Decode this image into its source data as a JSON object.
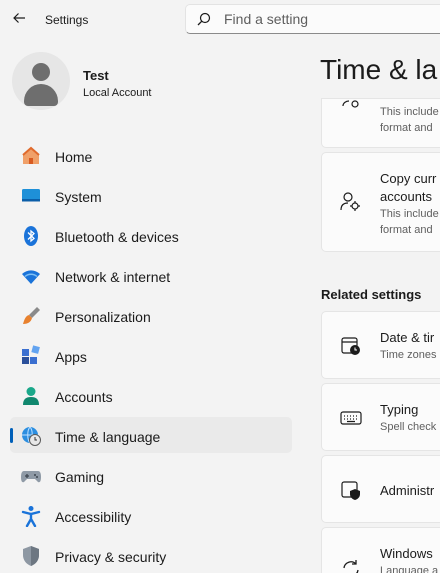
{
  "app": {
    "title": "Settings"
  },
  "search": {
    "placeholder": "Find a setting"
  },
  "profile": {
    "name": "Test",
    "account_type": "Local Account"
  },
  "nav": {
    "items": [
      {
        "label": "Home",
        "icon": "home-icon",
        "active": false
      },
      {
        "label": "System",
        "icon": "system-icon",
        "active": false
      },
      {
        "label": "Bluetooth & devices",
        "icon": "bluetooth-icon",
        "active": false
      },
      {
        "label": "Network & internet",
        "icon": "wifi-icon",
        "active": false
      },
      {
        "label": "Personalization",
        "icon": "brush-icon",
        "active": false
      },
      {
        "label": "Apps",
        "icon": "apps-icon",
        "active": false
      },
      {
        "label": "Accounts",
        "icon": "accounts-icon",
        "active": false
      },
      {
        "label": "Time & language",
        "icon": "globe-clock-icon",
        "active": true
      },
      {
        "label": "Gaming",
        "icon": "gamepad-icon",
        "active": false
      },
      {
        "label": "Accessibility",
        "icon": "accessibility-icon",
        "active": false
      },
      {
        "label": "Privacy & security",
        "icon": "shield-icon",
        "active": false
      }
    ]
  },
  "main": {
    "title": "Time & la",
    "top_card": {
      "line1": "This include",
      "line2": "format and"
    },
    "copy_card": {
      "title_line1": "Copy curr",
      "title_line2": "accounts",
      "line1": "This include",
      "line2": "format and"
    },
    "related_heading": "Related settings",
    "related": [
      {
        "title": "Date & tir",
        "subtitle": "Time zones",
        "icon": "calendar-clock-icon"
      },
      {
        "title": "Typing",
        "subtitle": "Spell check",
        "icon": "keyboard-icon"
      },
      {
        "title": "Administr",
        "subtitle": "",
        "icon": "shield-admin-icon"
      },
      {
        "title": "Windows",
        "subtitle": "Language a",
        "icon": "sync-icon"
      }
    ]
  },
  "colors": {
    "accent": "#005fb8",
    "background": "#f3f3f3",
    "card": "#fbfbfb"
  }
}
